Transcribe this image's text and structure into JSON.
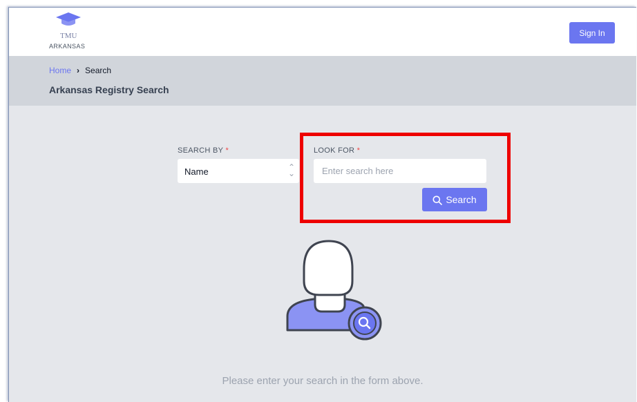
{
  "header": {
    "logo": {
      "line1": "TMU",
      "line2": "ARKANSAS",
      "icon": "graduation-cap-icon"
    },
    "sign_in_label": "Sign In"
  },
  "breadcrumb": {
    "home": "Home",
    "separator": "›",
    "current": "Search"
  },
  "page_title": "Arkansas Registry Search",
  "form": {
    "search_by": {
      "label": "SEARCH BY",
      "required_mark": "*",
      "value": "Name",
      "icon": "sort-chevrons-icon"
    },
    "look_for": {
      "label": "LOOK FOR",
      "required_mark": "*",
      "value": "",
      "placeholder": "Enter search here"
    },
    "search_button": {
      "label": "Search",
      "icon": "search-icon"
    }
  },
  "empty_state": {
    "illustration": "user-search-icon",
    "message": "Please enter your search in the form above."
  },
  "colors": {
    "accent": "#6b76f0",
    "page_bg": "#e5e7eb",
    "breadcrumb_bg": "#d1d5db",
    "required": "#ef4444",
    "highlight": "#ee0000"
  }
}
